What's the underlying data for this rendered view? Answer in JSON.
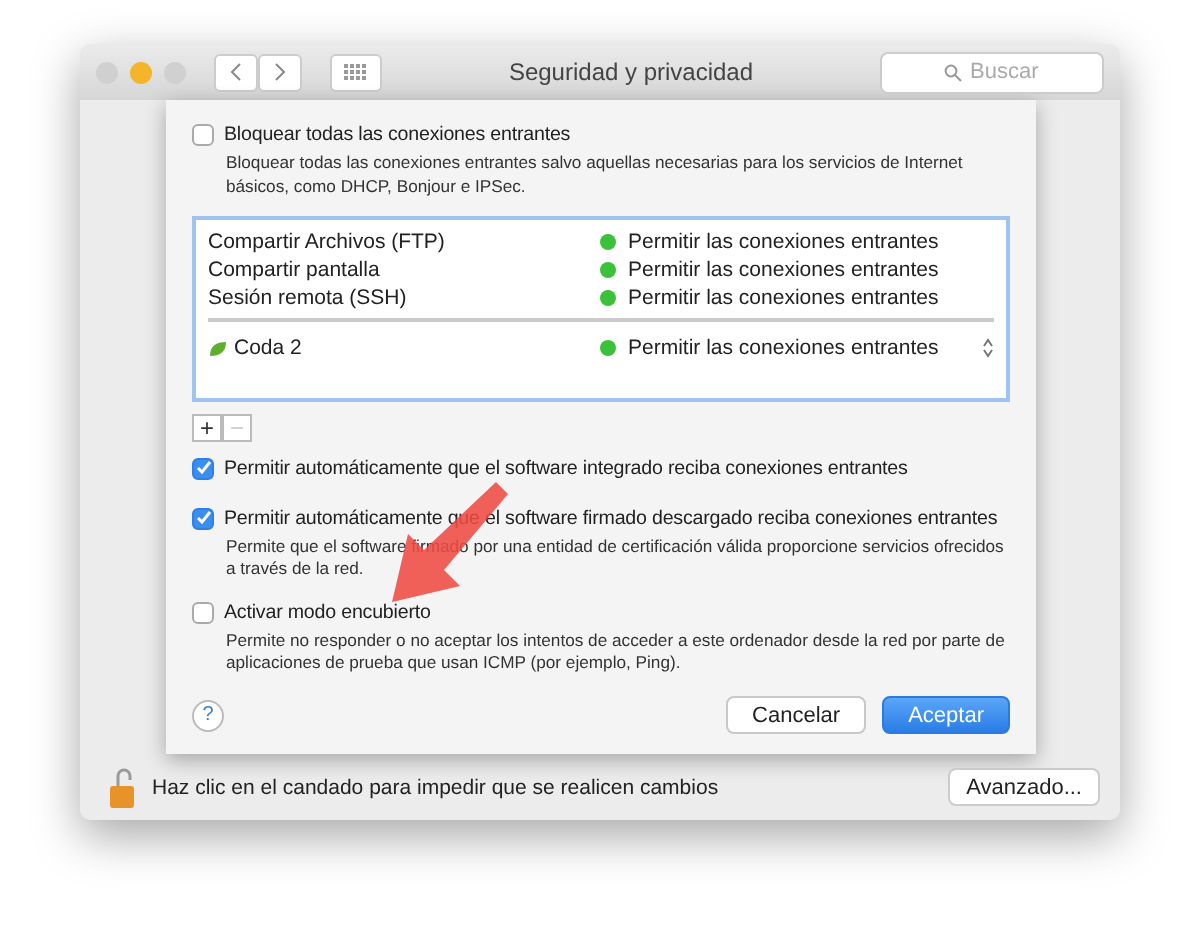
{
  "window": {
    "title": "Seguridad y privacidad",
    "search": {
      "placeholder": "Buscar"
    }
  },
  "block_all": {
    "label": "Bloquear todas las conexiones entrantes",
    "checked": false,
    "description": "Bloquear todas las conexiones entrantes salvo aquellas necesarias para los servicios de Internet básicos, como DHCP, Bonjour e IPSec."
  },
  "services": [
    {
      "name": "Compartir Archivos (FTP)",
      "status": "Permitir las conexiones entrantes",
      "color": "#3cc13b"
    },
    {
      "name": "Compartir pantalla",
      "status": "Permitir las conexiones entrantes",
      "color": "#3cc13b"
    },
    {
      "name": "Sesión remota (SSH)",
      "status": "Permitir las conexiones entrantes",
      "color": "#3cc13b"
    }
  ],
  "apps": [
    {
      "name": "Coda 2",
      "status": "Permitir las conexiones entrantes",
      "color": "#3cc13b"
    }
  ],
  "list_buttons": [
    "+",
    "−"
  ],
  "options": [
    {
      "label": "Permitir automáticamente que el software integrado reciba conexiones entrantes",
      "checked": true
    },
    {
      "label": "Permitir automáticamente que el software firmado descargado reciba conexiones entrantes",
      "checked": true,
      "description": "Permite que el software firmado por una entidad de certificación válida proporcione servicios ofrecidos a través de la red."
    },
    {
      "label": "Activar modo encubierto",
      "checked": false,
      "description": "Permite no responder o no aceptar los intentos de acceder a este ordenador desde la red por parte de aplicaciones de prueba que usan ICMP (por ejemplo, Ping)."
    }
  ],
  "help": "?",
  "buttons": [
    {
      "label": "Cancelar",
      "kind": "default"
    },
    {
      "label": "Aceptar",
      "kind": "primary"
    }
  ],
  "footer": {
    "lock_text": "Haz clic en el candado para impedir que se realicen cambios",
    "advanced": "Avanzado..."
  }
}
